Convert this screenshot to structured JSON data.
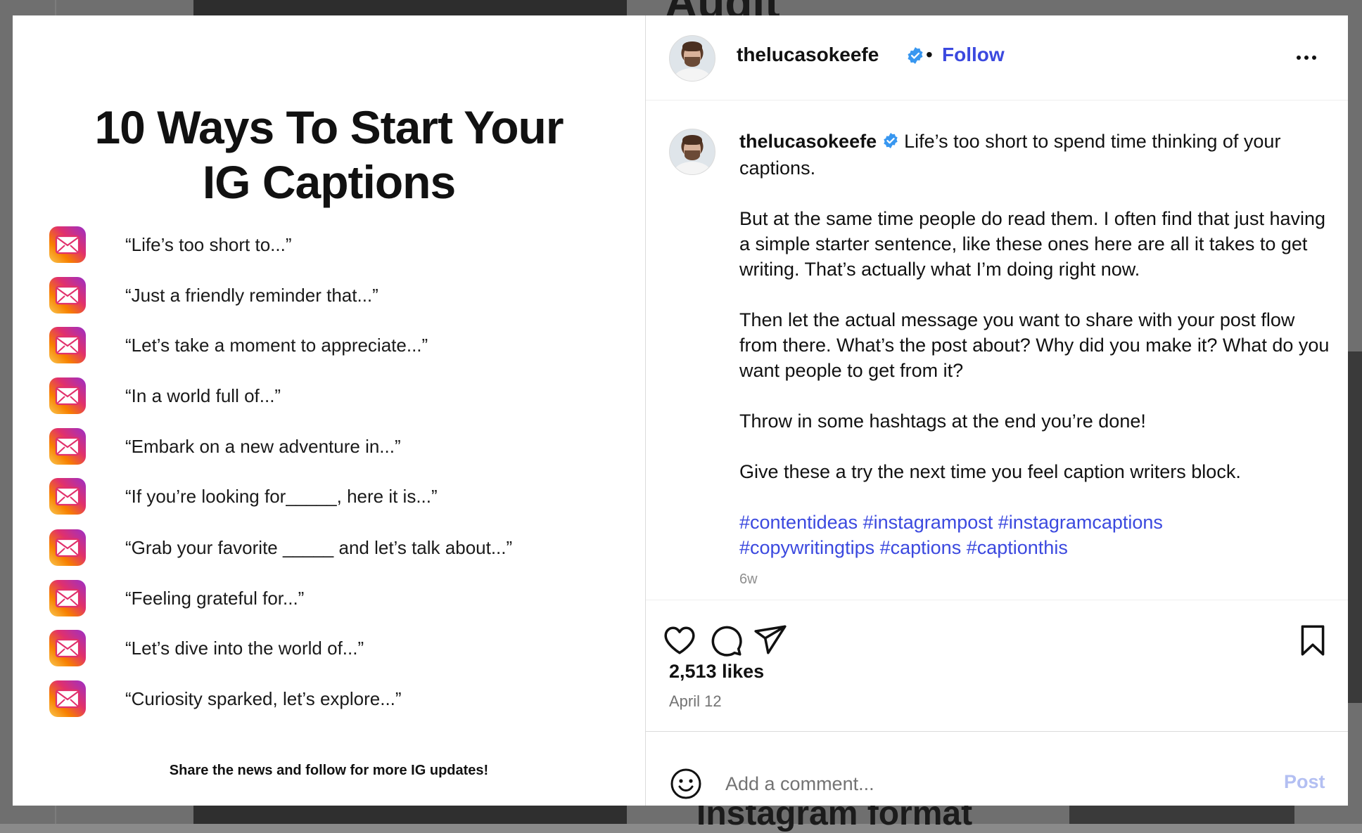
{
  "background": {
    "top_heading": "Audit",
    "bottom_heading": "Instagram format"
  },
  "post": {
    "media": {
      "title_line1": "10 Ways To Start Your",
      "title_line2": "IG Captions",
      "items": [
        "“Life’s too short to...”",
        "“Just a friendly reminder that...”",
        "“Let’s take a moment to appreciate...”",
        "“In a world full of...”",
        "“Embark on a new adventure in...”",
        "“If you’re looking for_____, here it is...”",
        "“Grab your favorite _____ and let’s talk about...”",
        "“Feeling grateful for...”",
        "“Let’s dive into the world of...”",
        "“Curiosity sparked, let’s explore...”"
      ],
      "item_icon": "mail-icon",
      "footer": "Share the news and follow for more IG updates!"
    },
    "header": {
      "username": "thelucasokeefe",
      "separator": "•",
      "follow_label": "Follow"
    },
    "caption": {
      "username": "thelucasokeefe",
      "paragraph1": "Life’s too short to spend time thinking of your captions.",
      "paragraph2": "But at the same time people do read them. I often find that just having a simple starter sentence, like these ones here are all it takes to get writing. That’s actually what I’m doing right now.",
      "paragraph3": "Then let the actual message you want to share with your post flow from there. What’s the post about? Why did you make it? What do you want people to get from it?",
      "paragraph4": "Throw in some hashtags at the end you’re done!",
      "paragraph5": "Give these a try the next time you feel caption writers block.",
      "hashtags": [
        "#contentideas",
        "#instagrampost",
        "#instagramcaptions",
        "#copywritingtips",
        "#captions",
        "#captionthis"
      ],
      "age": "6w"
    },
    "likes": "2,513 likes",
    "date": "April 12",
    "comment": {
      "placeholder": "Add a comment...",
      "post_label": "Post"
    }
  },
  "colors": {
    "link_blue": "#3b49df",
    "verified_blue": "#3897f0",
    "post_disabled": "#b3bff2"
  }
}
